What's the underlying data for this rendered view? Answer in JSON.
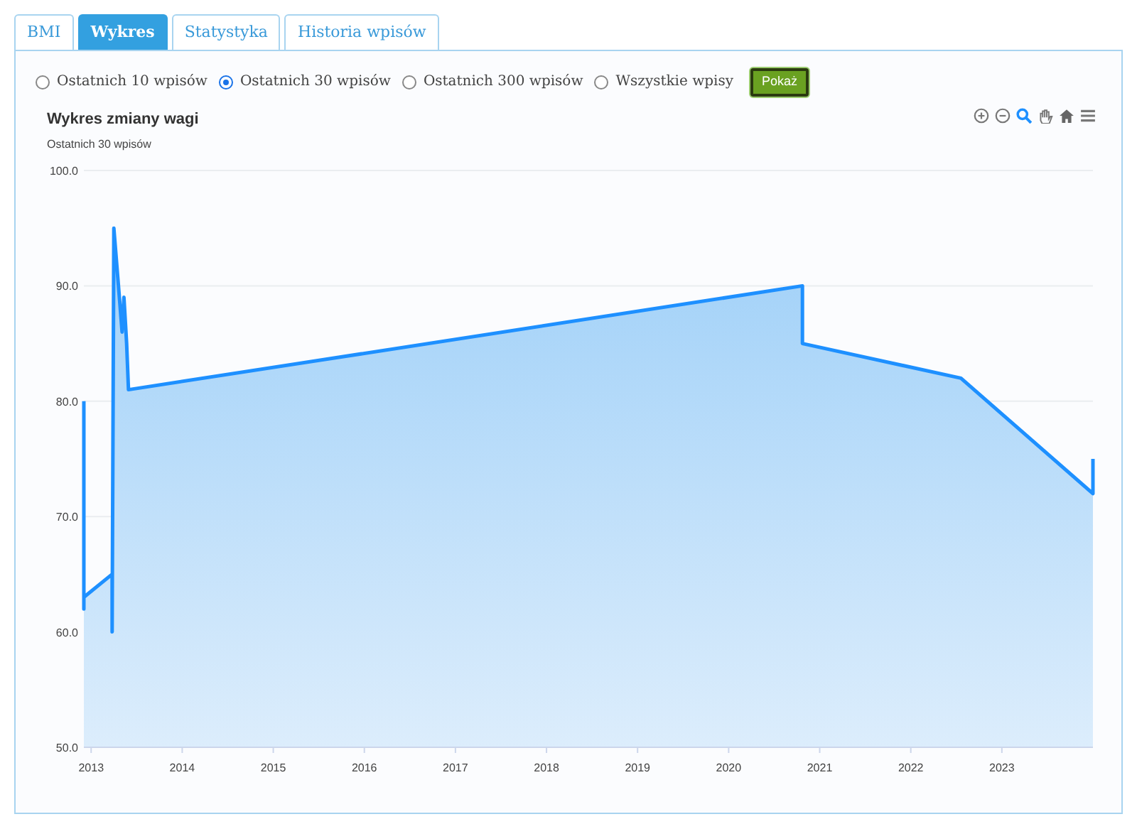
{
  "tabs": [
    {
      "label": "BMI",
      "selected": false
    },
    {
      "label": "Wykres",
      "selected": true
    },
    {
      "label": "Statystyka",
      "selected": false
    },
    {
      "label": "Historia wpisów",
      "selected": false
    }
  ],
  "range_options": [
    {
      "label": "Ostatnich 10 wpisów",
      "selected": false
    },
    {
      "label": "Ostatnich 30 wpisów",
      "selected": true
    },
    {
      "label": "Ostatnich 300 wpisów",
      "selected": false
    },
    {
      "label": "Wszystkie wpisy",
      "selected": false
    }
  ],
  "show_button": "Pokaż",
  "chart": {
    "subtitle": "Ostatnich 30 wpisów",
    "chart_data": {
      "type": "area",
      "title": "Wykres zmiany wagi",
      "x": [
        2012.92,
        2012.92,
        2012.92,
        2013.23,
        2013.23,
        2013.25,
        2013.33,
        2013.31,
        2013.34,
        2013.36,
        2013.39,
        2013.41,
        2020.81,
        2020.81,
        2022.55,
        2024.0,
        2024.0
      ],
      "grid": true,
      "series": [
        {
          "color": "#1e90ff",
          "values": [
            80,
            62,
            63,
            65,
            60,
            95,
            87,
            89,
            86,
            89,
            85,
            81,
            90,
            85,
            82,
            72,
            75
          ]
        }
      ],
      "xlim": [
        2012.92,
        2024.0
      ],
      "ylim": [
        50,
        100
      ],
      "xticks": [
        {
          "value": 2013,
          "label": "2013"
        },
        {
          "value": 2014,
          "label": "2014"
        },
        {
          "value": 2015,
          "label": "2015"
        },
        {
          "value": 2016,
          "label": "2016"
        },
        {
          "value": 2017,
          "label": "2017"
        },
        {
          "value": 2018,
          "label": "2018"
        },
        {
          "value": 2019,
          "label": "2019"
        },
        {
          "value": 2020,
          "label": "2020"
        },
        {
          "value": 2021,
          "label": "2021"
        },
        {
          "value": 2022,
          "label": "2022"
        },
        {
          "value": 2023,
          "label": "2023"
        }
      ],
      "yticks": [
        {
          "value": 50,
          "label": "50.0"
        },
        {
          "value": 60,
          "label": "60.0"
        },
        {
          "value": 70,
          "label": "70.0"
        },
        {
          "value": 80,
          "label": "80.0"
        },
        {
          "value": 90,
          "label": "90.0"
        },
        {
          "value": 100,
          "label": "100.0"
        }
      ]
    }
  }
}
